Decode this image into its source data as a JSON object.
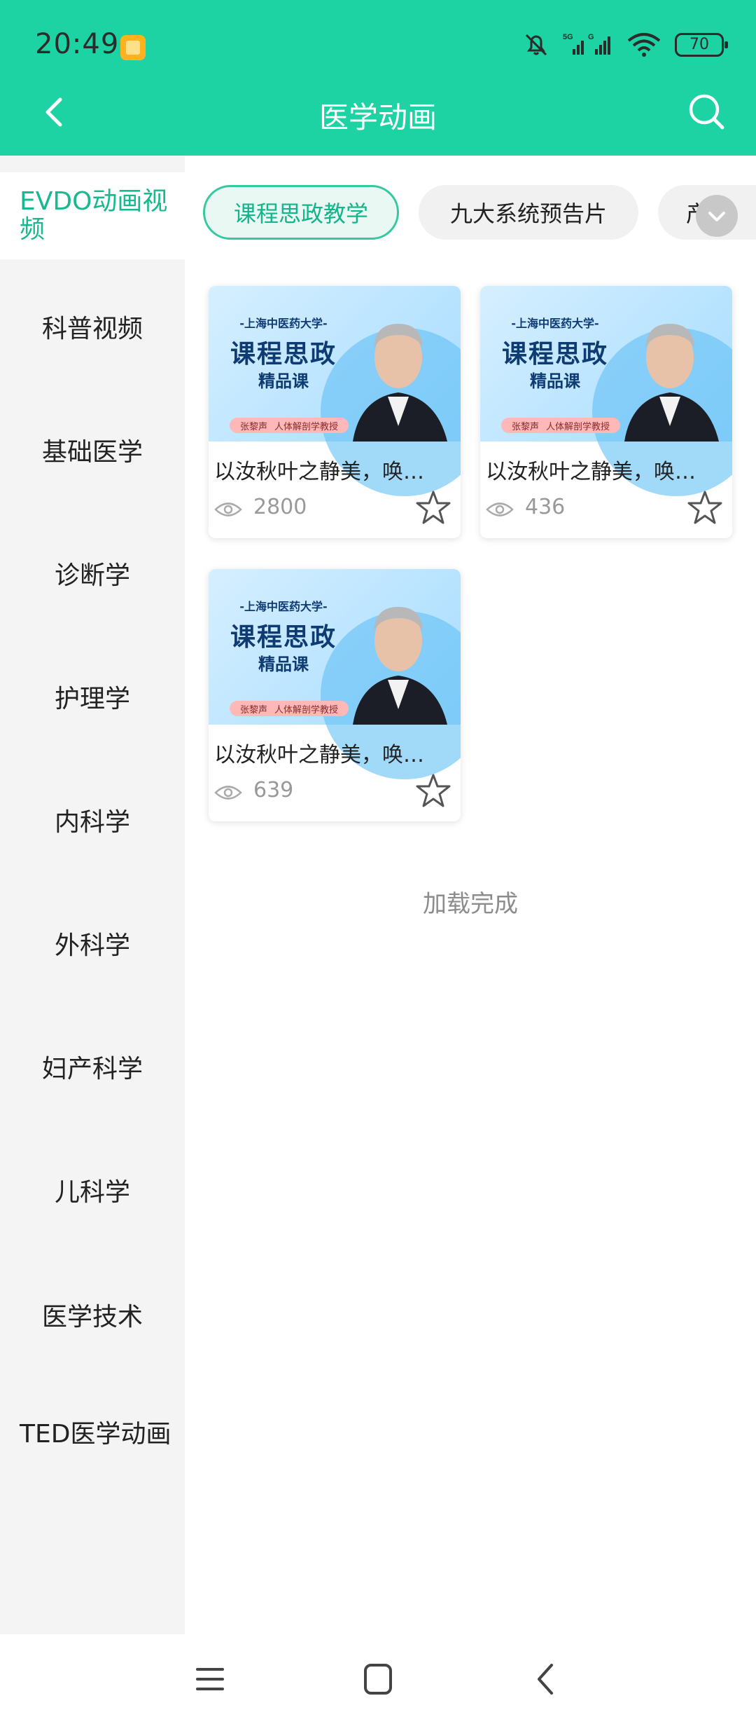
{
  "status_bar": {
    "time": "20:49",
    "battery": "70"
  },
  "app_bar": {
    "title": "医学动画"
  },
  "sidebar": {
    "items": [
      {
        "label": "EVDO动画视频",
        "active": true
      },
      {
        "label": "科普视频"
      },
      {
        "label": "基础医学"
      },
      {
        "label": "诊断学"
      },
      {
        "label": "护理学"
      },
      {
        "label": "内科学"
      },
      {
        "label": "外科学"
      },
      {
        "label": "妇产科学"
      },
      {
        "label": "儿科学"
      },
      {
        "label": "医学技术"
      },
      {
        "label": "TED医学动画"
      }
    ]
  },
  "chips": [
    {
      "label": "课程思政教学",
      "active": true
    },
    {
      "label": "九大系统预告片"
    },
    {
      "label": "产"
    }
  ],
  "cards": [
    {
      "title": "以汝秋叶之静美，唤…",
      "views": "2800",
      "thumb": {
        "brand": "-上海中医药大学-",
        "course": "课程思政",
        "sub": "精品课",
        "name": "张黎声",
        "role": "人体解剖学教授"
      }
    },
    {
      "title": "以汝秋叶之静美，唤…",
      "views": "436",
      "thumb": {
        "brand": "-上海中医药大学-",
        "course": "课程思政",
        "sub": "精品课",
        "name": "张黎声",
        "role": "人体解剖学教授"
      }
    },
    {
      "title": "以汝秋叶之静美，唤…",
      "views": "639",
      "thumb": {
        "brand": "-上海中医药大学-",
        "course": "课程思政",
        "sub": "精品课",
        "name": "张黎声",
        "role": "人体解剖学教授"
      }
    }
  ],
  "footer": {
    "loaded_text": "加载完成"
  },
  "colors": {
    "accent": "#1dd3a3",
    "active_text": "#18b890"
  }
}
